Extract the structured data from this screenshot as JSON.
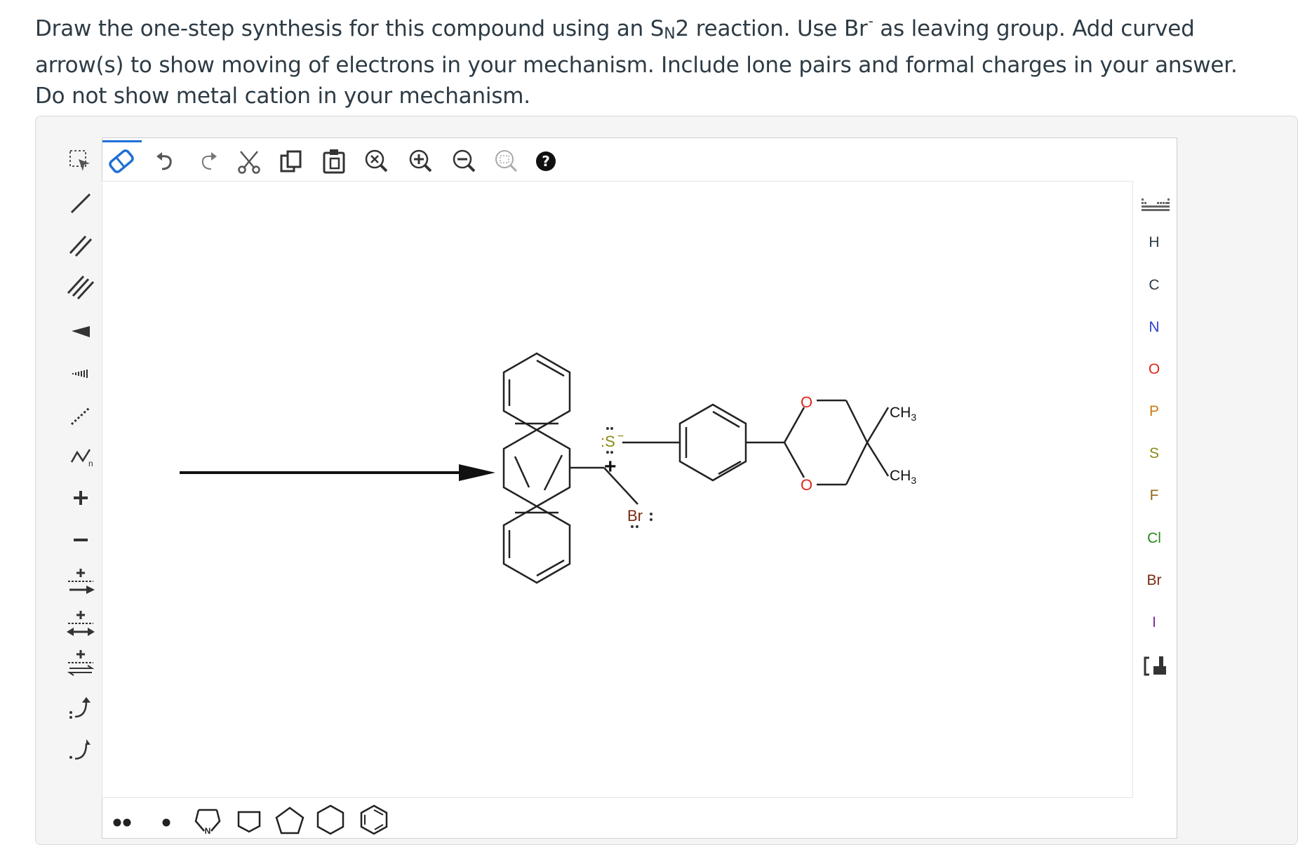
{
  "question": {
    "part1": "Draw the one-step synthesis for this compound using an S",
    "sub": "N",
    "part2": "2 reaction. Use Br",
    "sup": "-",
    "part3": " as leaving group. Add curved arrow(s) to show moving of electrons in your mechanism. Include lone pairs and formal charges in your answer. Do not show metal cation in your mechanism."
  },
  "top_toolbar": [
    "select-icon",
    "eraser-icon",
    "undo-icon",
    "redo-icon",
    "cut-icon",
    "copy-icon",
    "paste-icon",
    "zoom-reset-icon",
    "zoom-in-icon",
    "zoom-out-icon",
    "zoom-fit-icon",
    "help-icon"
  ],
  "left_toolbar": [
    "single-bond-icon",
    "double-bond-icon",
    "triple-bond-icon",
    "wedge-bond-icon",
    "hash-bond-icon",
    "dashed-bond-icon",
    "chain-icon",
    "plus-charge-icon",
    "minus-charge-icon",
    "reaction-arrow-icon",
    "equilibrium-arrow-icon",
    "resonance-arrow-icon",
    "electron-pair-arrow-icon",
    "single-electron-arrow-icon"
  ],
  "periodic_table_label": "periodic-table-icon",
  "elements": [
    "H",
    "C",
    "N",
    "O",
    "P",
    "S",
    "F",
    "Cl",
    "Br",
    "I"
  ],
  "element_colors": {
    "H": "#333333",
    "C": "#333333",
    "N": "#2e3fd0",
    "O": "#e0271b",
    "P": "#c97a12",
    "S": "#8a8a14",
    "F": "#8f6a12",
    "Cl": "#2a8a1e",
    "Br": "#7a2a14",
    "I": "#7a2a9a"
  },
  "bottom_toolbar": [
    "lone-pair-icon",
    "radical-icon",
    "pyrrole-ring-icon",
    "cyclobutane-ring-icon",
    "cyclopentane-ring-icon",
    "cyclohexane-ring-icon",
    "benzene-ring-icon"
  ],
  "canvas": {
    "sulfur": ":S",
    "sulfur_charge": "−",
    "plus": "+",
    "bromine": "Br",
    "bromine_pairs": ":",
    "oxygen_top": "O",
    "oxygen_bottom": "O",
    "methyl_top": "CH",
    "methyl_top_sub": "3",
    "methyl_bottom": "CH",
    "methyl_bottom_sub": "3"
  }
}
